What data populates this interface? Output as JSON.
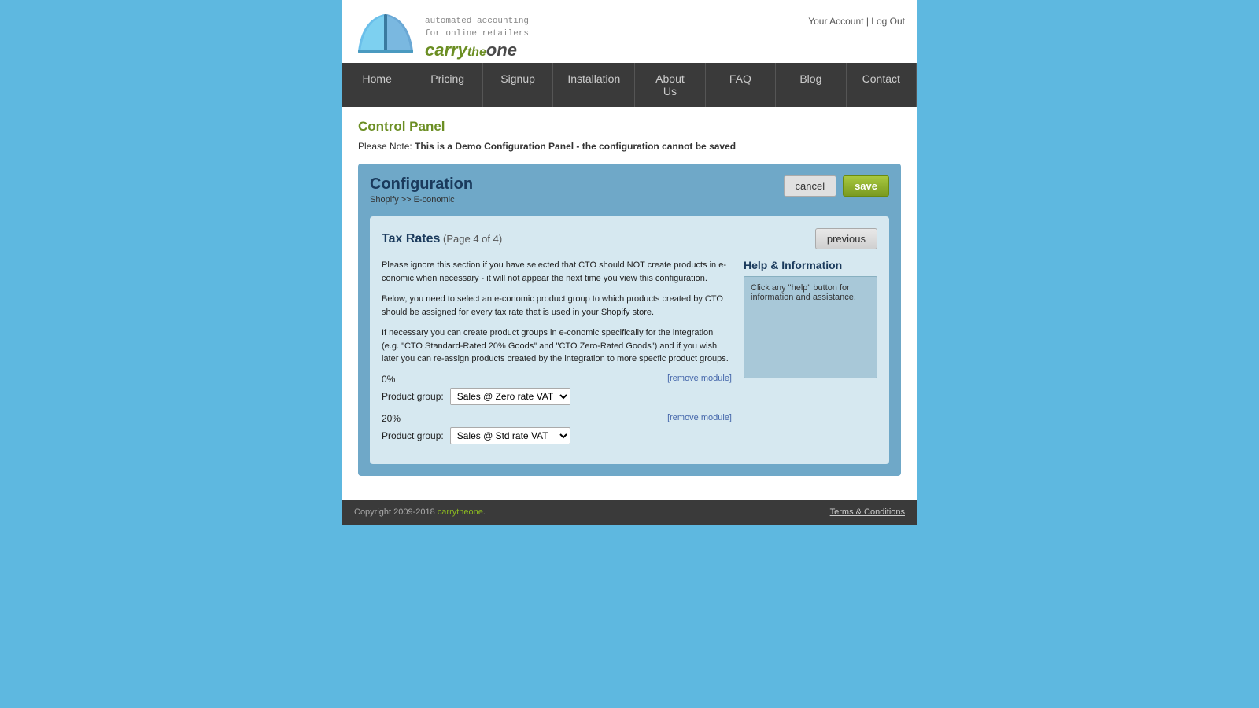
{
  "header": {
    "tagline_line1": "automated accounting",
    "tagline_line2": "for online retailers",
    "brand_carry": "carry",
    "brand_the": "the",
    "brand_one": "one",
    "account_link": "Your Account",
    "separator": "|",
    "logout_link": "Log Out"
  },
  "nav": {
    "items": [
      {
        "label": "Home",
        "id": "home"
      },
      {
        "label": "Pricing",
        "id": "pricing"
      },
      {
        "label": "Signup",
        "id": "signup"
      },
      {
        "label": "Installation",
        "id": "installation"
      },
      {
        "label": "About Us",
        "id": "about"
      },
      {
        "label": "FAQ",
        "id": "faq"
      },
      {
        "label": "Blog",
        "id": "blog"
      },
      {
        "label": "Contact",
        "id": "contact"
      }
    ]
  },
  "main": {
    "control_panel_title": "Control Panel",
    "demo_note_prefix": "Please Note: ",
    "demo_note_bold": "This is a Demo Configuration Panel - the configuration cannot be saved"
  },
  "config": {
    "title": "Configuration",
    "subtitle": "Shopify >> E-conomic",
    "cancel_label": "cancel",
    "save_label": "save",
    "tax_rates": {
      "title": "Tax Rates",
      "page_label": "(Page 4 of 4)",
      "previous_label": "previous",
      "para1": "Please ignore this section if you have selected that CTO should NOT create products in e-conomic when necessary - it will not appear the next time you view this configuration.",
      "para2": "Below, you need to select an e-conomic product group to which products created by CTO should be assigned for every tax rate that is used in your Shopify store.",
      "para3": "If necessary you can create product groups in e-conomic specifically for the integration (e.g. \"CTO Standard-Rated 20% Goods\" and \"CTO Zero-Rated Goods\") and if you wish later you can re-assign products created by the integration to more specfic product groups.",
      "rate_0": {
        "label": "0%",
        "remove_label": "[remove module]",
        "product_group_label": "Product group:",
        "select_value": "Sales @ Zero rate VAT",
        "select_options": [
          "Sales @ Zero rate VAT",
          "Sales @ Std rate VAT"
        ]
      },
      "rate_20": {
        "label": "20%",
        "remove_label": "[remove module]",
        "product_group_label": "Product group:",
        "select_value": "Sales @ Std rate VAT",
        "select_options": [
          "Sales @ Zero rate VAT",
          "Sales @ Std rate VAT"
        ]
      }
    },
    "help": {
      "title": "Help & Information",
      "content": "Click any \"help\" button for information and assistance."
    }
  },
  "footer": {
    "copyright": "Copyright 2009-2018 ",
    "brand": "carrytheone",
    "brand_suffix": ".",
    "terms_label": "Terms & Conditions"
  }
}
